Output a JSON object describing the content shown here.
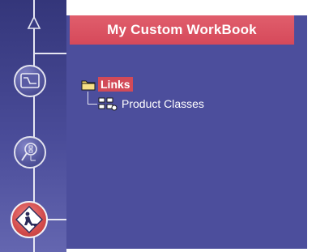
{
  "panel": {
    "title": "My Custom WorkBook"
  },
  "rail": {
    "buttons": [
      {
        "icon": "chart-waveform-icon",
        "active": false
      },
      {
        "icon": "search-tree-icon",
        "active": false
      },
      {
        "icon": "construction-sign-icon",
        "active": true
      }
    ]
  },
  "tree": {
    "root": {
      "label": "Links",
      "icon": "folder-icon",
      "selected": true
    },
    "children": [
      {
        "label": "Product Classes",
        "icon": "classes-icon"
      }
    ]
  },
  "colors": {
    "rail_top": "#34367a",
    "panel_bg": "#4c4e9c",
    "header_bg": "#d6495a",
    "selection_bg": "#d24a58",
    "text": "#ffffff"
  }
}
